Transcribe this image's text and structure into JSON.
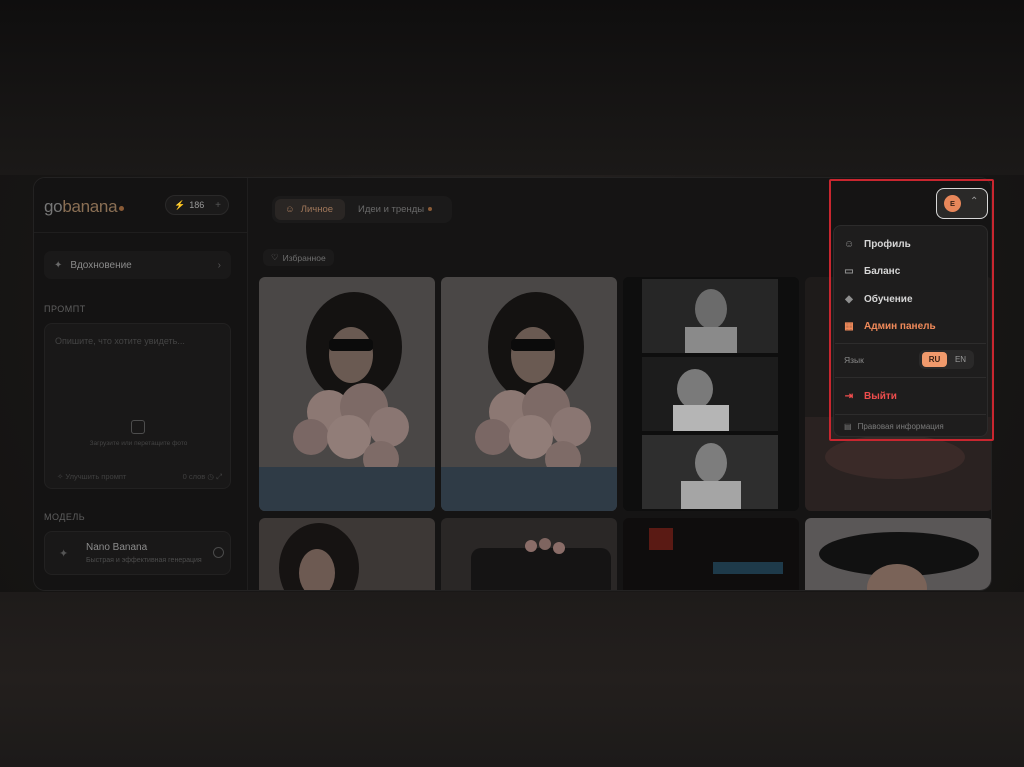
{
  "app": {
    "logo_go": "go",
    "logo_banana": "banana",
    "credits": "186",
    "credits_add": "+"
  },
  "sidebar": {
    "inspiration_label": "Вдохновение",
    "prompt_section": "ПРОМПТ",
    "prompt_placeholder": "Опишите, что хотите увидеть...",
    "upload_hint": "Загрузите или перетащите фото",
    "improve_prompt": "Улучшить промпт",
    "word_count": "0 слов",
    "model_section": "МОДЕЛЬ",
    "model_name": "Nano Banana",
    "model_desc": "Быстрая и эффективная генерация"
  },
  "header": {
    "tabs": [
      {
        "label": "Личное",
        "active": true
      },
      {
        "label": "Идеи и тренды",
        "active": false
      }
    ],
    "favorites_label": "Избранное"
  },
  "user": {
    "avatar_letter": "E"
  },
  "menu": {
    "items": [
      {
        "label": "Профиль",
        "icon": "user-icon"
      },
      {
        "label": "Баланс",
        "icon": "wallet-icon"
      },
      {
        "label": "Обучение",
        "icon": "graduation-cap-icon"
      },
      {
        "label": "Админ панель",
        "icon": "admin-grid-icon"
      }
    ],
    "language_label": "Язык",
    "languages": [
      {
        "code": "RU",
        "active": true
      },
      {
        "code": "EN",
        "active": false
      }
    ],
    "logout_label": "Выйти",
    "legal_label": "Правовая информация"
  },
  "colors": {
    "accent": "#f08a5a",
    "danger": "#ef4d4d",
    "highlight": "#c9262f"
  }
}
